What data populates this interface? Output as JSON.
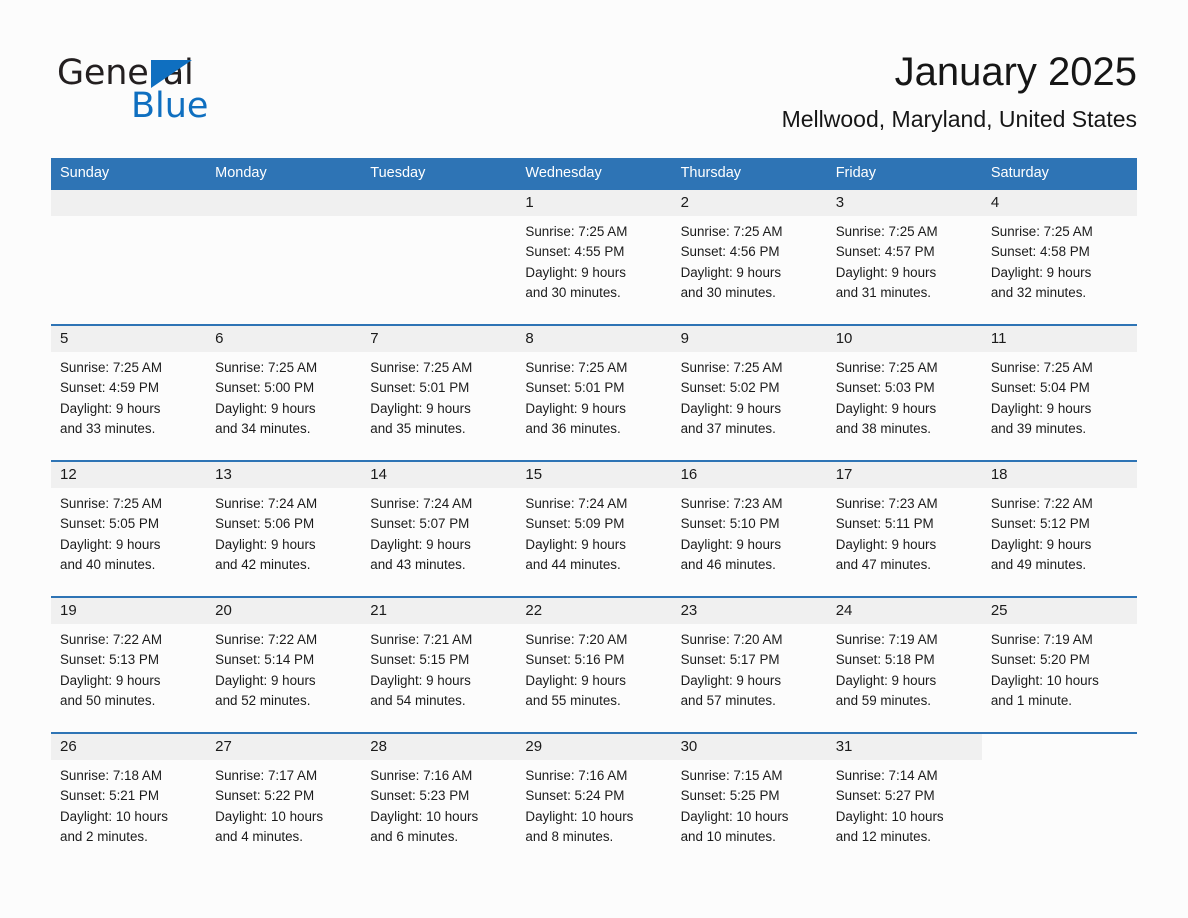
{
  "brand": {
    "name_part1": "General",
    "name_part2": "Blue",
    "triangle_icon": "triangle-icon",
    "accent_color": "#0f6fc0"
  },
  "header": {
    "title": "January 2025",
    "location": "Mellwood, Maryland, United States"
  },
  "theme": {
    "header_blue": "#2e74b5",
    "daynum_band": "#f0f0f0",
    "page_background": "#fcfcfc",
    "text": "#1b1b1b"
  },
  "weekdays": [
    "Sunday",
    "Monday",
    "Tuesday",
    "Wednesday",
    "Thursday",
    "Friday",
    "Saturday"
  ],
  "weeks": [
    [
      {
        "day": "",
        "blank": true,
        "sunrise": "",
        "sunset": "",
        "daylight1": "",
        "daylight2": ""
      },
      {
        "day": "",
        "blank": true,
        "sunrise": "",
        "sunset": "",
        "daylight1": "",
        "daylight2": ""
      },
      {
        "day": "",
        "blank": true,
        "sunrise": "",
        "sunset": "",
        "daylight1": "",
        "daylight2": ""
      },
      {
        "day": "1",
        "sunrise": "Sunrise: 7:25 AM",
        "sunset": "Sunset: 4:55 PM",
        "daylight1": "Daylight: 9 hours",
        "daylight2": "and 30 minutes."
      },
      {
        "day": "2",
        "sunrise": "Sunrise: 7:25 AM",
        "sunset": "Sunset: 4:56 PM",
        "daylight1": "Daylight: 9 hours",
        "daylight2": "and 30 minutes."
      },
      {
        "day": "3",
        "sunrise": "Sunrise: 7:25 AM",
        "sunset": "Sunset: 4:57 PM",
        "daylight1": "Daylight: 9 hours",
        "daylight2": "and 31 minutes."
      },
      {
        "day": "4",
        "sunrise": "Sunrise: 7:25 AM",
        "sunset": "Sunset: 4:58 PM",
        "daylight1": "Daylight: 9 hours",
        "daylight2": "and 32 minutes."
      }
    ],
    [
      {
        "day": "5",
        "sunrise": "Sunrise: 7:25 AM",
        "sunset": "Sunset: 4:59 PM",
        "daylight1": "Daylight: 9 hours",
        "daylight2": "and 33 minutes."
      },
      {
        "day": "6",
        "sunrise": "Sunrise: 7:25 AM",
        "sunset": "Sunset: 5:00 PM",
        "daylight1": "Daylight: 9 hours",
        "daylight2": "and 34 minutes."
      },
      {
        "day": "7",
        "sunrise": "Sunrise: 7:25 AM",
        "sunset": "Sunset: 5:01 PM",
        "daylight1": "Daylight: 9 hours",
        "daylight2": "and 35 minutes."
      },
      {
        "day": "8",
        "sunrise": "Sunrise: 7:25 AM",
        "sunset": "Sunset: 5:01 PM",
        "daylight1": "Daylight: 9 hours",
        "daylight2": "and 36 minutes."
      },
      {
        "day": "9",
        "sunrise": "Sunrise: 7:25 AM",
        "sunset": "Sunset: 5:02 PM",
        "daylight1": "Daylight: 9 hours",
        "daylight2": "and 37 minutes."
      },
      {
        "day": "10",
        "sunrise": "Sunrise: 7:25 AM",
        "sunset": "Sunset: 5:03 PM",
        "daylight1": "Daylight: 9 hours",
        "daylight2": "and 38 minutes."
      },
      {
        "day": "11",
        "sunrise": "Sunrise: 7:25 AM",
        "sunset": "Sunset: 5:04 PM",
        "daylight1": "Daylight: 9 hours",
        "daylight2": "and 39 minutes."
      }
    ],
    [
      {
        "day": "12",
        "sunrise": "Sunrise: 7:25 AM",
        "sunset": "Sunset: 5:05 PM",
        "daylight1": "Daylight: 9 hours",
        "daylight2": "and 40 minutes."
      },
      {
        "day": "13",
        "sunrise": "Sunrise: 7:24 AM",
        "sunset": "Sunset: 5:06 PM",
        "daylight1": "Daylight: 9 hours",
        "daylight2": "and 42 minutes."
      },
      {
        "day": "14",
        "sunrise": "Sunrise: 7:24 AM",
        "sunset": "Sunset: 5:07 PM",
        "daylight1": "Daylight: 9 hours",
        "daylight2": "and 43 minutes."
      },
      {
        "day": "15",
        "sunrise": "Sunrise: 7:24 AM",
        "sunset": "Sunset: 5:09 PM",
        "daylight1": "Daylight: 9 hours",
        "daylight2": "and 44 minutes."
      },
      {
        "day": "16",
        "sunrise": "Sunrise: 7:23 AM",
        "sunset": "Sunset: 5:10 PM",
        "daylight1": "Daylight: 9 hours",
        "daylight2": "and 46 minutes."
      },
      {
        "day": "17",
        "sunrise": "Sunrise: 7:23 AM",
        "sunset": "Sunset: 5:11 PM",
        "daylight1": "Daylight: 9 hours",
        "daylight2": "and 47 minutes."
      },
      {
        "day": "18",
        "sunrise": "Sunrise: 7:22 AM",
        "sunset": "Sunset: 5:12 PM",
        "daylight1": "Daylight: 9 hours",
        "daylight2": "and 49 minutes."
      }
    ],
    [
      {
        "day": "19",
        "sunrise": "Sunrise: 7:22 AM",
        "sunset": "Sunset: 5:13 PM",
        "daylight1": "Daylight: 9 hours",
        "daylight2": "and 50 minutes."
      },
      {
        "day": "20",
        "sunrise": "Sunrise: 7:22 AM",
        "sunset": "Sunset: 5:14 PM",
        "daylight1": "Daylight: 9 hours",
        "daylight2": "and 52 minutes."
      },
      {
        "day": "21",
        "sunrise": "Sunrise: 7:21 AM",
        "sunset": "Sunset: 5:15 PM",
        "daylight1": "Daylight: 9 hours",
        "daylight2": "and 54 minutes."
      },
      {
        "day": "22",
        "sunrise": "Sunrise: 7:20 AM",
        "sunset": "Sunset: 5:16 PM",
        "daylight1": "Daylight: 9 hours",
        "daylight2": "and 55 minutes."
      },
      {
        "day": "23",
        "sunrise": "Sunrise: 7:20 AM",
        "sunset": "Sunset: 5:17 PM",
        "daylight1": "Daylight: 9 hours",
        "daylight2": "and 57 minutes."
      },
      {
        "day": "24",
        "sunrise": "Sunrise: 7:19 AM",
        "sunset": "Sunset: 5:18 PM",
        "daylight1": "Daylight: 9 hours",
        "daylight2": "and 59 minutes."
      },
      {
        "day": "25",
        "sunrise": "Sunrise: 7:19 AM",
        "sunset": "Sunset: 5:20 PM",
        "daylight1": "Daylight: 10 hours",
        "daylight2": "and 1 minute."
      }
    ],
    [
      {
        "day": "26",
        "sunrise": "Sunrise: 7:18 AM",
        "sunset": "Sunset: 5:21 PM",
        "daylight1": "Daylight: 10 hours",
        "daylight2": "and 2 minutes."
      },
      {
        "day": "27",
        "sunrise": "Sunrise: 7:17 AM",
        "sunset": "Sunset: 5:22 PM",
        "daylight1": "Daylight: 10 hours",
        "daylight2": "and 4 minutes."
      },
      {
        "day": "28",
        "sunrise": "Sunrise: 7:16 AM",
        "sunset": "Sunset: 5:23 PM",
        "daylight1": "Daylight: 10 hours",
        "daylight2": "and 6 minutes."
      },
      {
        "day": "29",
        "sunrise": "Sunrise: 7:16 AM",
        "sunset": "Sunset: 5:24 PM",
        "daylight1": "Daylight: 10 hours",
        "daylight2": "and 8 minutes."
      },
      {
        "day": "30",
        "sunrise": "Sunrise: 7:15 AM",
        "sunset": "Sunset: 5:25 PM",
        "daylight1": "Daylight: 10 hours",
        "daylight2": "and 10 minutes."
      },
      {
        "day": "31",
        "sunrise": "Sunrise: 7:14 AM",
        "sunset": "Sunset: 5:27 PM",
        "daylight1": "Daylight: 10 hours",
        "daylight2": "and 12 minutes."
      },
      {
        "day": "",
        "blank": true,
        "sunrise": "",
        "sunset": "",
        "daylight1": "",
        "daylight2": ""
      }
    ]
  ]
}
